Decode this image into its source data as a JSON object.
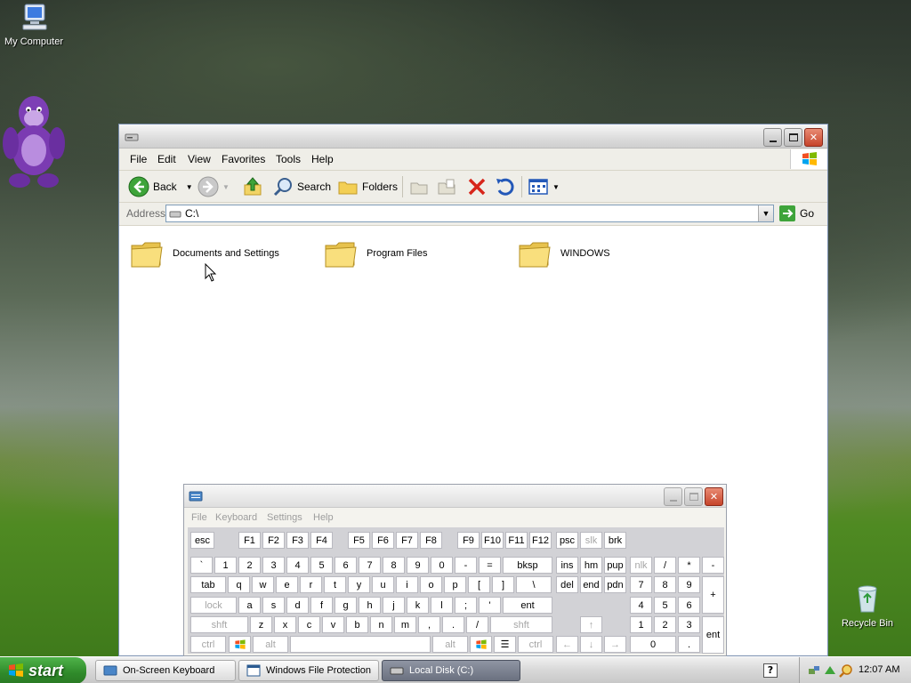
{
  "desktop": {
    "icons": {
      "my_computer": "My Computer",
      "recycle_bin": "Recycle Bin"
    }
  },
  "explorer": {
    "menu": [
      "File",
      "Edit",
      "View",
      "Favorites",
      "Tools",
      "Help"
    ],
    "toolbar": {
      "back": "Back",
      "search": "Search",
      "folders": "Folders"
    },
    "address": {
      "label": "Address",
      "value": "C:\\",
      "go": "Go"
    },
    "folders": [
      "Documents and Settings",
      "Program Files",
      "WINDOWS"
    ]
  },
  "osk": {
    "menu": [
      "File",
      "Keyboard",
      "Settings",
      "Help"
    ],
    "rows": {
      "fn": [
        "esc",
        "F1",
        "F2",
        "F3",
        "F4",
        "F5",
        "F6",
        "F7",
        "F8",
        "F9",
        "F10",
        "F11",
        "F12",
        "psc",
        "slk",
        "brk"
      ],
      "num": [
        "`",
        "1",
        "2",
        "3",
        "4",
        "5",
        "6",
        "7",
        "8",
        "9",
        "0",
        "-",
        "=",
        "bksp",
        "ins",
        "hm",
        "pup",
        "nlk",
        "/",
        "*",
        "-"
      ],
      "tab": [
        "tab",
        "q",
        "w",
        "e",
        "r",
        "t",
        "y",
        "u",
        "i",
        "o",
        "p",
        "[",
        "]",
        "\\",
        "del",
        "end",
        "pdn",
        "7",
        "8",
        "9",
        "+"
      ],
      "home": [
        "lock",
        "a",
        "s",
        "d",
        "f",
        "g",
        "h",
        "j",
        "k",
        "l",
        ";",
        "'",
        "ent",
        "4",
        "5",
        "6"
      ],
      "shift": [
        "shft",
        "z",
        "x",
        "c",
        "v",
        "b",
        "n",
        "m",
        ",",
        ".",
        "/",
        "shft",
        "1",
        "2",
        "3",
        "ent"
      ],
      "bottom": [
        "ctrl",
        "alt",
        "alt",
        "ctrl",
        "0",
        "."
      ]
    }
  },
  "taskbar": {
    "start": "start",
    "tasks": [
      "On-Screen Keyboard",
      "Windows File Protection",
      "Local Disk (C:)"
    ],
    "clock": "12:07 AM"
  }
}
